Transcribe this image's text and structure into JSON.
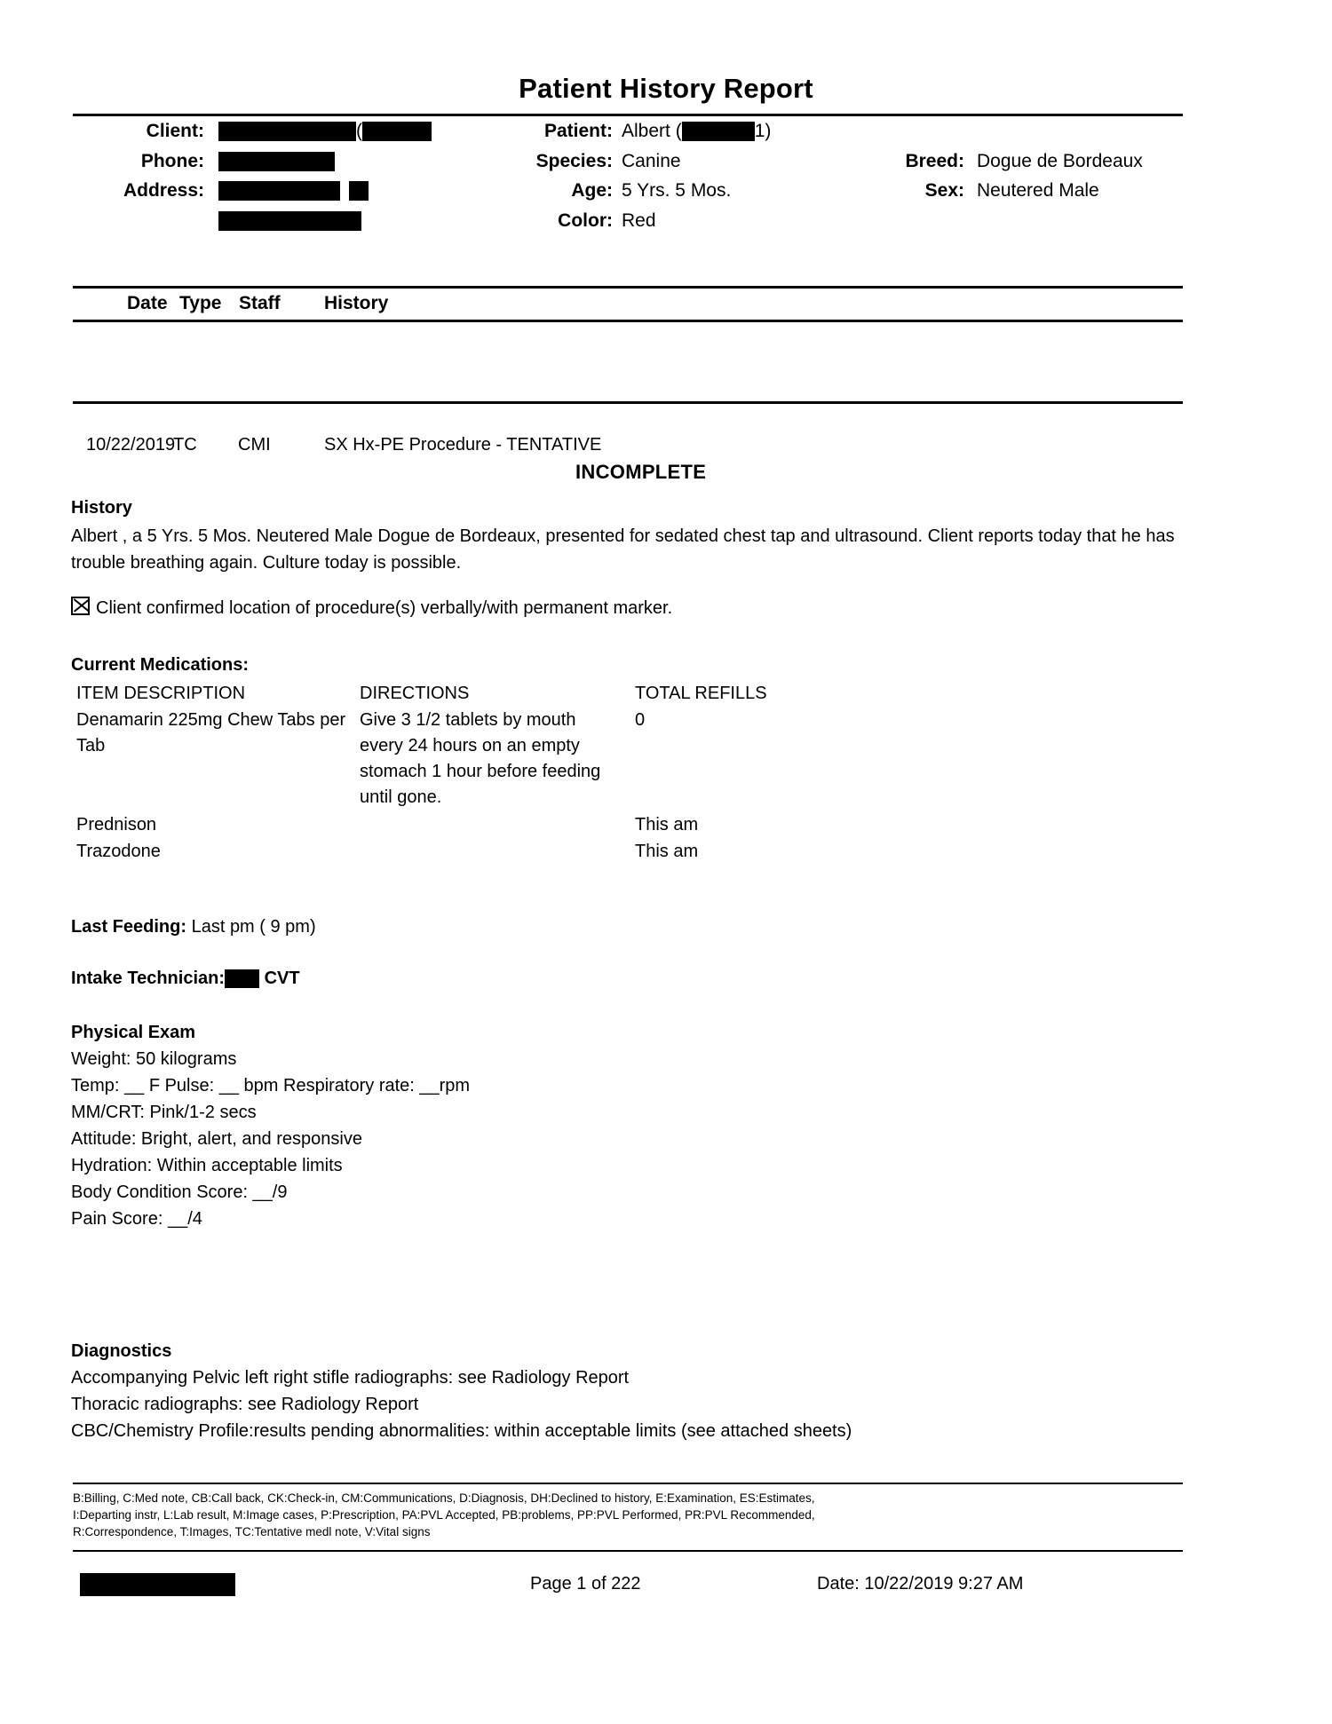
{
  "document": {
    "title": "Patient History Report"
  },
  "client_block": {
    "client_label": "Client:",
    "phone_label": "Phone:",
    "address_label": "Address:",
    "client_paren": "(",
    "redactions": {
      "client_bar_1_width": 155,
      "client_bar_2_width": 78,
      "phone_bar_width": 131,
      "address_bar_1_width": 137,
      "address_bar_2_width": 22,
      "address_bar_3_width": 161
    }
  },
  "patient_block": {
    "patient_label": "Patient:",
    "patient_name": "Albert (",
    "patient_name_suffix": "1)",
    "species_label": "Species:",
    "species_value": "Canine",
    "age_label": "Age:",
    "age_value": "5 Yrs. 5 Mos.",
    "color_label": "Color:",
    "color_value": "Red",
    "breed_label": "Breed:",
    "breed_value": "Dogue de Bordeaux",
    "sex_label": "Sex:",
    "sex_value": "Neutered Male"
  },
  "table_headers": {
    "date": "Date",
    "type": "Type",
    "staff": "Staff",
    "history": "History"
  },
  "entry": {
    "date": "10/22/2019",
    "type": "TC",
    "staff": "CMI",
    "history_title": "SX Hx-PE Procedure - TENTATIVE",
    "status": "INCOMPLETE"
  },
  "history_section": {
    "heading": "History",
    "text": "Albert , a 5 Yrs. 5 Mos.  Neutered Male  Dogue de Bordeaux, presented for sedated chest tap and ultrasound.  Client reports today that he has trouble breathing again. Culture today is possible.",
    "confirmation_checkbox_label": "Client confirmed location of procedure(s) verbally/with permanent marker.",
    "confirmation_checked": true
  },
  "medications": {
    "heading": "Current Medications:",
    "columns": {
      "item": "ITEM DESCRIPTION",
      "directions": "DIRECTIONS",
      "refills": "TOTAL REFILLS"
    },
    "rows": [
      {
        "item": "Denamarin 225mg Chew Tabs per Tab",
        "directions": "Give 3 1/2 tablets by mouth every 24 hours on an empty stomach 1 hour before feeding until gone.",
        "refills": "0"
      },
      {
        "item": "Prednison",
        "directions": "",
        "refills": "This am"
      },
      {
        "item": "Trazodone",
        "directions": "",
        "refills": "This am"
      }
    ]
  },
  "last_feeding": {
    "label": "Last Feeding:",
    "value": "Last pm ( 9 pm)"
  },
  "intake_technician": {
    "label": "Intake Technician:",
    "credential": "CVT",
    "redaction_width": 39
  },
  "physical_exam": {
    "heading": "Physical Exam",
    "lines": [
      "Weight:  50 kilograms",
      "Temp:  __ F         Pulse:  __ bpm     Respiratory rate:   __rpm",
      "MM/CRT:  Pink/1-2 secs",
      "Attitude:  Bright, alert, and responsive",
      "Hydration:  Within acceptable limits",
      "Body Condition Score:  __/9",
      "Pain Score: __/4"
    ]
  },
  "diagnostics": {
    "heading": "Diagnostics",
    "lines": [
      "Accompanying Pelvic left right stifle radiographs: see Radiology Report",
      "Thoracic radiographs: see Radiology Report",
      "CBC/Chemistry Profile:results pending abnormalities: within acceptable limits (see attached sheets)"
    ]
  },
  "legend": {
    "line1": "B:Billing, C:Med note, CB:Call back, CK:Check-in, CM:Communications, D:Diagnosis, DH:Declined to history, E:Examination, ES:Estimates,",
    "line2": "I:Departing instr, L:Lab result, M:Image cases, P:Prescription, PA:PVL Accepted, PB:problems, PP:PVL Performed, PR:PVL Recommended,",
    "line3": "R:Correspondence, T:Images, TC:Tentative medl note, V:Vital signs"
  },
  "page_footer": {
    "page_number": "Page 1 of 222",
    "date": "Date: 10/22/2019 9:27 AM",
    "redaction_width": 175
  }
}
